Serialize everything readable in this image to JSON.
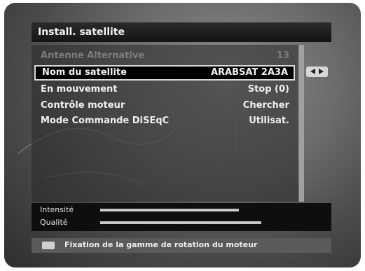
{
  "title": "Install. satellite",
  "menu": {
    "rows": [
      {
        "label": "Antenne Alternative",
        "value": "13"
      },
      {
        "label": "Nom du satellite",
        "value": "ARABSAT 2A3A"
      },
      {
        "label": "En mouvement",
        "value": "Stop (0)"
      },
      {
        "label": "Contrôle moteur",
        "value": "Chercher"
      },
      {
        "label": "Mode Commande DiSEqC",
        "value": "Utilisat."
      }
    ]
  },
  "signal": {
    "intensity_label": "Intensité",
    "intensity_level": 0.63,
    "quality_label": "Qualité",
    "quality_level": 0.73
  },
  "help": {
    "text": "Fixation de la gamme de rotation du moteur"
  },
  "icons": {
    "arrows": "left-right-arrows-icon",
    "help_key": "remote-key-icon"
  }
}
